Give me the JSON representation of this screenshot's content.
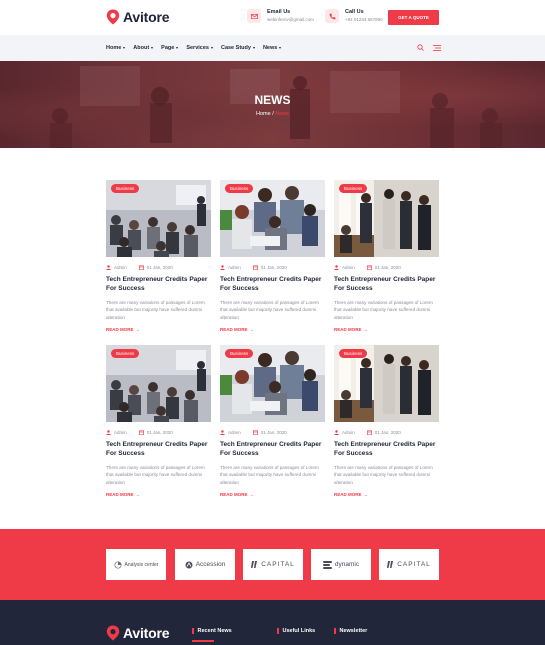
{
  "brand": {
    "name": "Avitore"
  },
  "header": {
    "email_label": "Email Us",
    "email_value": "webinfernv@gmail.com",
    "call_label": "Call Us",
    "call_value": "+84 01234 567890",
    "quote_button": "GET A QUOTE"
  },
  "nav": {
    "items": [
      {
        "label": "Home"
      },
      {
        "label": "About"
      },
      {
        "label": "Page"
      },
      {
        "label": "Services"
      },
      {
        "label": "Case Study"
      },
      {
        "label": "News"
      }
    ]
  },
  "banner": {
    "title": "NEWS",
    "breadcrumb_home": "Home",
    "breadcrumb_sep": "/",
    "breadcrumb_current": "News"
  },
  "news": [
    {
      "badge": "Business",
      "author": "Admin",
      "date": "01 Jan, 2020",
      "title": "Tech Entrepreneur Credits Paper For Success",
      "excerpt": "There are many variations of passages of Lorem that available but majority have suffered dummi alteration",
      "read_more": "READ MORE"
    },
    {
      "badge": "Business",
      "author": "Admin",
      "date": "01 Jan, 2020",
      "title": "Tech Entrepreneur Credits Paper For Success",
      "excerpt": "There are many variations of passages of Lorem that available but majority have suffered dummi alteration",
      "read_more": "READ MORE"
    },
    {
      "badge": "Business",
      "author": "Admin",
      "date": "01 Jan, 2020",
      "title": "Tech Entrepreneur Credits Paper For Success",
      "excerpt": "There are many variations of passages of Lorem that available but majority have suffered dummi alteration",
      "read_more": "READ MORE"
    },
    {
      "badge": "Business",
      "author": "Admin",
      "date": "01 Jan, 2020",
      "title": "Tech Entrepreneur Credits Paper For Success",
      "excerpt": "There are many variations of passages of Lorem that available but majority have suffered dummi alteration",
      "read_more": "READ MORE"
    },
    {
      "badge": "Business",
      "author": "Admin",
      "date": "01 Jan, 2020",
      "title": "Tech Entrepreneur Credits Paper For Success",
      "excerpt": "There are many variations of passages of Lorem that available but majority have suffered dummi alteration",
      "read_more": "READ MORE"
    },
    {
      "badge": "Business",
      "author": "Admin",
      "date": "01 Jan, 2020",
      "title": "Tech Entrepreneur Credits Paper For Success",
      "excerpt": "There are many variations of passages of Lorem that available but majority have suffered dummi alteration",
      "read_more": "READ MORE"
    }
  ],
  "partners": [
    {
      "name": "Analysis center"
    },
    {
      "name": "Accession"
    },
    {
      "name": "CAPITAL"
    },
    {
      "name": "dynamic"
    },
    {
      "name": "CAPITAL"
    }
  ],
  "footer": {
    "col1": "Recent News",
    "col2": "Useful Links",
    "col3": "Newsletter"
  },
  "colors": {
    "accent": "#ef3a47",
    "dark": "#1f2436",
    "footer_bg": "#22263a"
  }
}
